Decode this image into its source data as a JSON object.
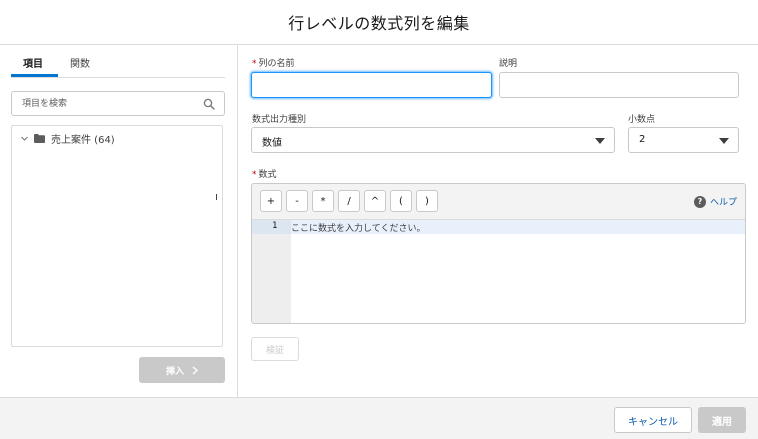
{
  "modal": {
    "title": "行レベルの数式列を編集"
  },
  "left": {
    "tabs": [
      {
        "label": "項目",
        "active": true
      },
      {
        "label": "関数",
        "active": false
      }
    ],
    "search": {
      "placeholder": "項目を検索",
      "value": ""
    },
    "tree": [
      {
        "label": "売上案件 (64)",
        "icon": "folder-icon",
        "expanded": true
      }
    ],
    "insert_label": "挿入"
  },
  "form": {
    "column_name": {
      "label": "列の名前",
      "required": true,
      "value": ""
    },
    "description": {
      "label": "説明",
      "value": ""
    },
    "output_type": {
      "label": "数式出力種別",
      "value": "数値"
    },
    "decimals": {
      "label": "小数点",
      "value": "2"
    },
    "formula": {
      "label": "数式",
      "required": true,
      "operators": [
        "+",
        "-",
        "*",
        "/",
        "^",
        "(",
        ")"
      ],
      "help_label": "ヘルプ",
      "line_number": "1",
      "placeholder": "ここに数式を入力してください。"
    },
    "verify_label": "検証"
  },
  "footer": {
    "cancel_label": "キャンセル",
    "apply_label": "適用"
  },
  "colors": {
    "accent": "#0176d3",
    "focus": "#1b96ff",
    "required": "#ba0517",
    "disabled": "#c9c9c9",
    "link": "#0b5cab"
  }
}
